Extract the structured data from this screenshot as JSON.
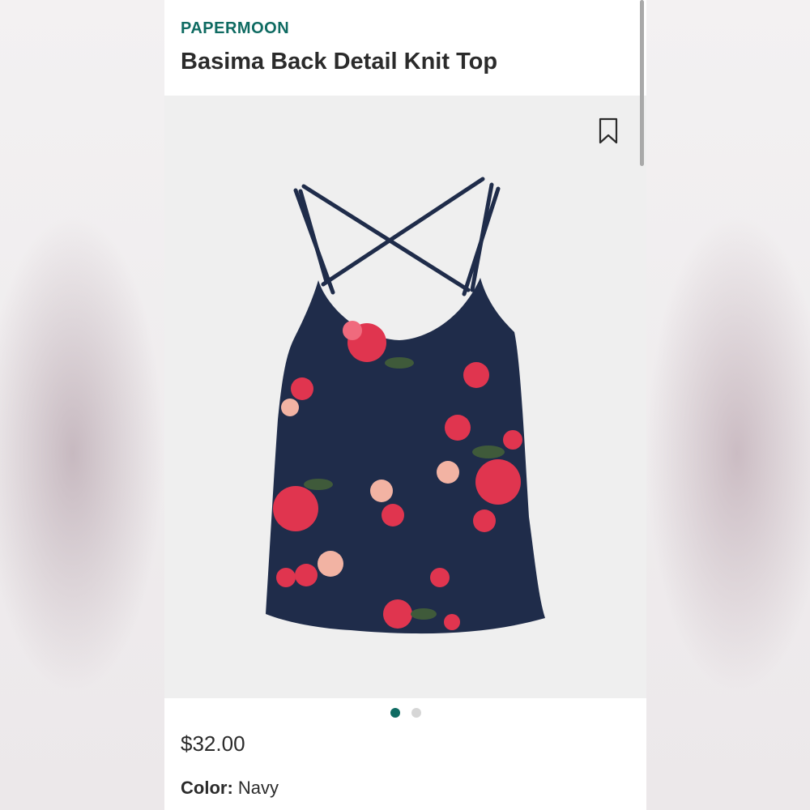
{
  "product": {
    "brand": "PAPERMOON",
    "title": "Basima Back Detail Knit Top",
    "price": "$32.00",
    "color_label": "Color:",
    "color_value": "Navy"
  },
  "gallery": {
    "image_count": 2,
    "active_index": 0,
    "bookmark_icon": "bookmark-icon"
  },
  "colors": {
    "brand": "#0f6b62",
    "garment": "#1f2c4a",
    "flower": "#e0354f"
  }
}
